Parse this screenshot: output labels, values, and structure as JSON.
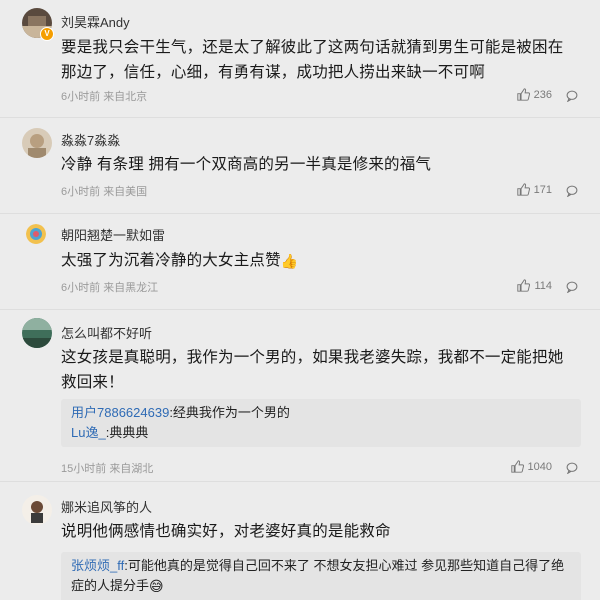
{
  "comments": [
    {
      "user": "刘昊霖Andy",
      "badge": "V",
      "text": "要是我只会干生气，还是太了解彼此了这两句话就猜到男生可能是被困在那边了，信任，心细，有勇有谋，成功把人捞出来缺一不可啊",
      "time": "6小时前",
      "location": "来自北京",
      "likes": "236"
    },
    {
      "user": "淼淼7淼淼",
      "text": "冷静 有条理 拥有一个双商高的另一半真是修来的福气",
      "time": "6小时前",
      "location": "来自美国",
      "likes": "171"
    },
    {
      "user": "朝阳翘楚一默如雷",
      "text": "太强了为沉着冷静的大女主点赞",
      "emoji": "👍",
      "time": "6小时前",
      "location": "来自黑龙江",
      "likes": "114"
    },
    {
      "user": "怎么叫都不好听",
      "text": "这女孩是真聪明，我作为一个男的，如果我老婆失踪，我都不一定能把她救回来！",
      "replies": [
        {
          "user": "用户7886624639",
          "text": ":经典我作为一个男的"
        },
        {
          "user": "Lu逸_",
          "text": ":典典典"
        }
      ],
      "time": "15小时前",
      "location": "来自湖北",
      "likes": "1040"
    },
    {
      "user": "娜米追风筝的人",
      "text": "说明他俩感情也确实好，对老婆好真的是能救命",
      "replies": [
        {
          "user": "张烦烦_ff",
          "text": ":可能他真的是觉得自己回不来了 不想女友担心难过 参见那些知道自己得了绝症的人提分手",
          "emoji": "😅"
        }
      ]
    }
  ],
  "colors": {
    "background": "#ececec",
    "link": "#2f6bb5",
    "badge": "#f59e00"
  },
  "icons": {
    "like": "thumbs-up-icon",
    "reply": "comment-bubble-icon",
    "verified": "verified-badge-icon"
  }
}
